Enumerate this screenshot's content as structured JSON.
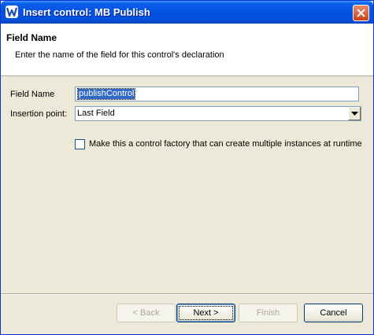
{
  "window": {
    "title": "Insert control: MB Publish"
  },
  "header": {
    "title": "Field Name",
    "description": "Enter the name of the field for this control's declaration"
  },
  "form": {
    "field_name_label": "Field Name",
    "field_name_value": "publishControl",
    "insertion_point_label": "Insertion point:",
    "insertion_point_value": "Last Field",
    "factory_checkbox_label": "Make this a control factory that can create multiple instances at runtime",
    "factory_checked": false
  },
  "buttons": {
    "back": "< Back",
    "next": "Next >",
    "finish": "Finish",
    "cancel": "Cancel"
  },
  "icons": {
    "app": "app-w-icon",
    "close": "close-icon",
    "dropdown": "chevron-down-icon"
  },
  "colors": {
    "titlebar": "#0454e2",
    "selection": "#316ac5",
    "dialog_bg": "#ece9d8"
  }
}
